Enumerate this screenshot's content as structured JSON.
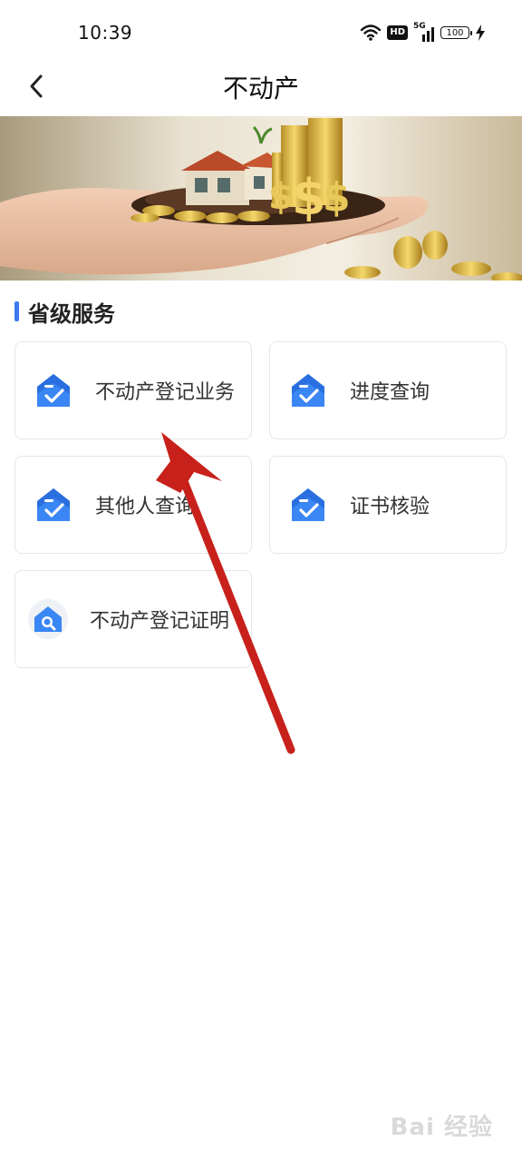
{
  "status_bar": {
    "time": "10:39",
    "hd_label": "HD",
    "network_label": "5G",
    "battery_level": "100"
  },
  "header": {
    "title": "不动产",
    "back_icon": "chevron-left-icon"
  },
  "banner": {
    "description_icon": "hand-house-coins-image"
  },
  "section": {
    "title": "省级服务",
    "accent_color": "#3a7bf0"
  },
  "services": [
    {
      "label": "不动产登记业务",
      "icon": "house-check-icon"
    },
    {
      "label": "进度查询",
      "icon": "house-check-icon"
    },
    {
      "label": "其他人查询",
      "icon": "house-check-icon"
    },
    {
      "label": "证书核验",
      "icon": "house-check-icon"
    },
    {
      "label": "不动产登记证明",
      "icon": "house-search-icon"
    }
  ],
  "overlay": {
    "annotation_icon": "red-arrow-annotation",
    "color": "#c8201a"
  },
  "watermark": {
    "text": "Bai 经验"
  }
}
